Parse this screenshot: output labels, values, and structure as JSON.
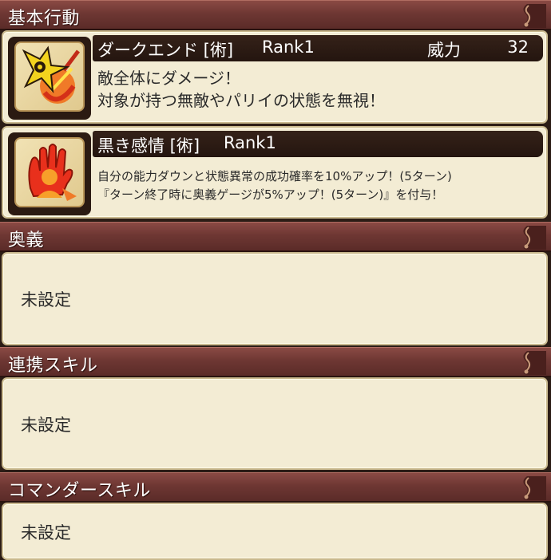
{
  "basic_action": {
    "title": "基本行動",
    "skills": [
      {
        "icon": "shuriken-slash-icon",
        "name": "ダークエンド [術]",
        "rank": "Rank1",
        "power_label": "威力",
        "power_value": "32",
        "description": [
          "敵全体にダメージ！",
          "対象が持つ無敵やパリイの状態を無視！"
        ]
      },
      {
        "icon": "dark-hand-icon",
        "name": "黒き感情 [術]",
        "rank": "Rank1",
        "description": [
          "自分の能力ダウンと状態異常の成功確率を10%アップ！(5ターン)",
          "『ターン終了時に奥義ゲージが5%アップ！(5ターン)』を付与！"
        ]
      }
    ]
  },
  "ougi": {
    "title": "奥義",
    "value": "未設定"
  },
  "renkei": {
    "title": "連携スキル",
    "value": "未設定"
  },
  "commander": {
    "title": "コマンダースキル",
    "value": "未設定"
  },
  "colors": {
    "header": "#6e3733",
    "card_background": "#f3ecd4",
    "name_bar": "#2a1a12"
  }
}
